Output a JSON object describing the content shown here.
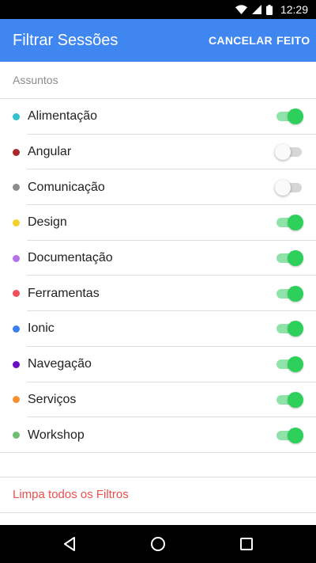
{
  "status_bar": {
    "time": "12:29",
    "icons": [
      "wifi-icon",
      "cell-signal-icon",
      "battery-icon"
    ]
  },
  "toolbar": {
    "title": "Filtrar Sessões",
    "cancel_label": "CANCELAR",
    "done_label": "FEITO",
    "background": "#3f86f0"
  },
  "section": {
    "header": "Assuntos"
  },
  "topics": [
    {
      "label": "Alimentação",
      "color": "#35c1cf",
      "enabled": true
    },
    {
      "label": "Angular",
      "color": "#a8282b",
      "enabled": false
    },
    {
      "label": "Comunicação",
      "color": "#8c8c8c",
      "enabled": false
    },
    {
      "label": "Design",
      "color": "#f5cf2a",
      "enabled": true
    },
    {
      "label": "Documentação",
      "color": "#b571ec",
      "enabled": true
    },
    {
      "label": "Ferramentas",
      "color": "#f04f5c",
      "enabled": true
    },
    {
      "label": "Ionic",
      "color": "#3b7ff0",
      "enabled": true
    },
    {
      "label": "Navegação",
      "color": "#6b0fc4",
      "enabled": true
    },
    {
      "label": "Serviços",
      "color": "#f79131",
      "enabled": true
    },
    {
      "label": "Workshop",
      "color": "#6fbf73",
      "enabled": true
    }
  ],
  "actions": {
    "clear_filters": "Limpa todos os Filtros",
    "clear_color": "#f04d4d"
  },
  "nav_bar": {
    "icons": [
      "back-icon",
      "home-icon",
      "recent-apps-icon"
    ]
  }
}
